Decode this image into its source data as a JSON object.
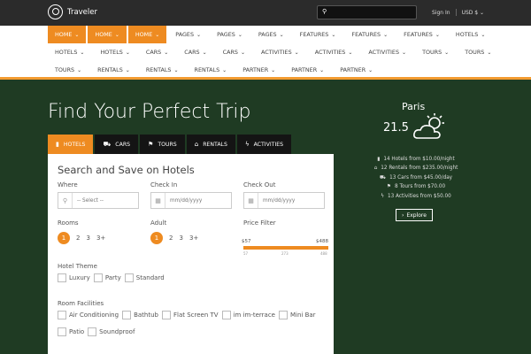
{
  "topbar": {
    "brand": "Traveler",
    "search_placeholder": "",
    "sign_in": "Sign In",
    "currency": "USD $",
    "chev": "⌄"
  },
  "nav": {
    "row1": [
      {
        "label": "HOME",
        "active": true
      },
      {
        "label": "HOME",
        "active": true
      },
      {
        "label": "HOME",
        "active": true
      },
      {
        "label": "PAGES"
      },
      {
        "label": "PAGES"
      },
      {
        "label": "PAGES"
      },
      {
        "label": "FEATURES"
      },
      {
        "label": "FEATURES"
      },
      {
        "label": "FEATURES"
      },
      {
        "label": "HOTELS"
      }
    ],
    "row2": [
      {
        "label": "HOTELS"
      },
      {
        "label": "HOTELS"
      },
      {
        "label": "CARS"
      },
      {
        "label": "CARS"
      },
      {
        "label": "CARS"
      },
      {
        "label": "ACTIVITIES"
      },
      {
        "label": "ACTIVITIES"
      },
      {
        "label": "ACTIVITIES"
      },
      {
        "label": "TOURS"
      },
      {
        "label": "TOURS"
      }
    ],
    "row3": [
      {
        "label": "TOURS"
      },
      {
        "label": "RENTALS"
      },
      {
        "label": "RENTALS"
      },
      {
        "label": "RENTALS"
      },
      {
        "label": "PARTNER"
      },
      {
        "label": "PARTNER"
      },
      {
        "label": "PARTNER"
      }
    ]
  },
  "hero": {
    "title": "Find Your Perfect Trip"
  },
  "tabs": [
    {
      "label": "HOTELS",
      "icon": "hotel-icon",
      "active": true
    },
    {
      "label": "CARS",
      "icon": "car-icon"
    },
    {
      "label": "TOURS",
      "icon": "flag-icon"
    },
    {
      "label": "RENTALS",
      "icon": "home-icon"
    },
    {
      "label": "ACTIVITIES",
      "icon": "bolt-icon"
    }
  ],
  "form": {
    "title": "Search and Save on Hotels",
    "where_label": "Where",
    "where_value": "-- Select --",
    "checkin_label": "Check In",
    "checkin_placeholder": "mm/dd/yyyy",
    "checkout_label": "Check Out",
    "checkout_placeholder": "mm/dd/yyyy",
    "rooms_label": "Rooms",
    "rooms_options": [
      "1",
      "2",
      "3",
      "3+"
    ],
    "rooms_selected": "1",
    "adult_label": "Adult",
    "adult_options": [
      "1",
      "2",
      "3",
      "3+"
    ],
    "adult_selected": "1",
    "price_label": "Price Filter",
    "price_min": "$57",
    "price_max": "$488",
    "price_ticks": [
      "57",
      "273",
      "488"
    ],
    "theme_label": "Hotel Theme",
    "themes": [
      "Luxury",
      "Party",
      "Standard"
    ],
    "facilities_label": "Room Facilities",
    "facilities_row1": [
      "Air Conditioning",
      "Bathtub",
      "Flat Screen TV",
      "im im-terrace",
      "Mini Bar"
    ],
    "facilities_row2": [
      "Patio",
      "Soundproof"
    ]
  },
  "weather": {
    "city": "Paris",
    "temp": "21.5",
    "icon": "partly-cloudy-icon"
  },
  "stats": [
    {
      "icon": "hotel-icon",
      "glyph": "▮",
      "text": "14 Hotels from $10.00/night"
    },
    {
      "icon": "home-icon",
      "glyph": "⌂",
      "text": "12 Rentals from $235.00/night"
    },
    {
      "icon": "car-icon",
      "glyph": "⛟",
      "text": "13 Cars from $45.00/day"
    },
    {
      "icon": "flag-icon",
      "glyph": "⚑",
      "text": "8 Tours from $70.00"
    },
    {
      "icon": "bolt-icon",
      "glyph": "ϟ",
      "text": "13 Activities from $50.00"
    }
  ],
  "explore_label": "Explore",
  "colors": {
    "accent": "#ee8b21",
    "hero_bg": "#1f3b23",
    "topbar": "#2b2b2b"
  }
}
